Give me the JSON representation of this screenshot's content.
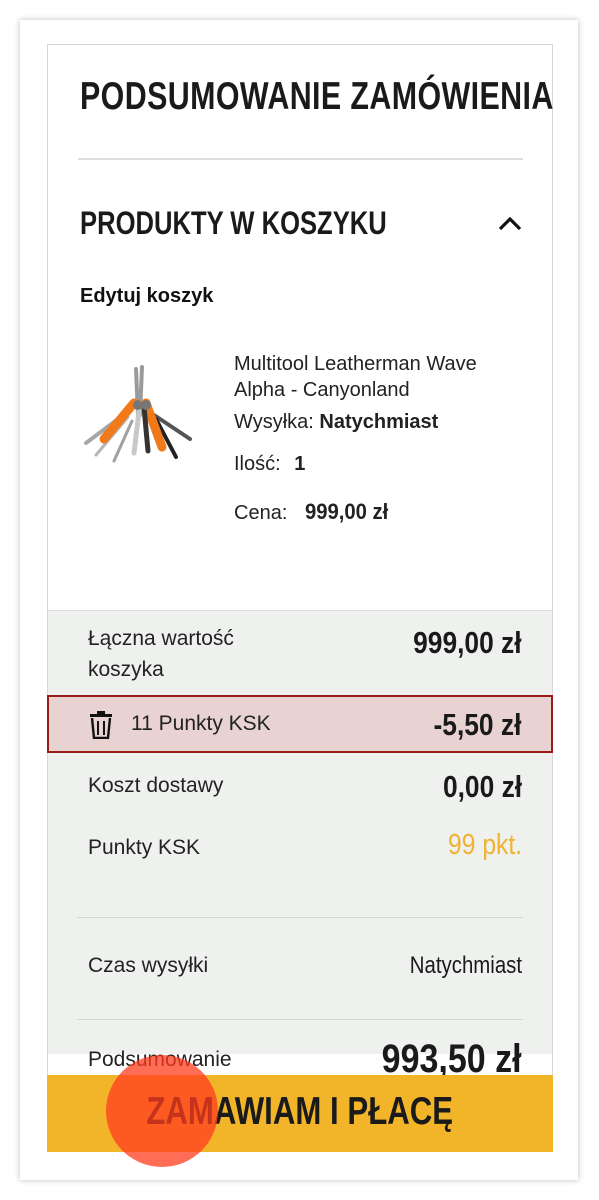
{
  "order_summary": {
    "title": "PODSUMOWANIE ZAMÓWIENIA",
    "cart_section": {
      "heading": "PRODUKTY W KOSZYKU",
      "toggle_icon": "chevron-up-icon",
      "edit_link": "Edytuj koszyk"
    },
    "product": {
      "name": "Multitool Leatherman Wave Alpha - Canyonland",
      "shipping_label": "Wysyłka:",
      "shipping_value": "Natychmiast",
      "qty_label": "Ilość:",
      "qty_value": "1",
      "price_label": "Cena:",
      "price_value": "999,00 zł"
    },
    "totals": {
      "cart_value_label": "Łączna wartość koszyka",
      "cart_value": "999,00 zł",
      "discount_label": "11 Punkty KSK",
      "discount_value": "-5,50 zł",
      "discount_icon": "trash-icon",
      "delivery_label": "Koszt dostawy",
      "delivery_value": "0,00 zł",
      "points_label": "Punkty KSK",
      "points_value": "99 pkt.",
      "ship_time_label": "Czas wysyłki",
      "ship_time_value": "Natychmiast",
      "summary_label": "Podsumowanie",
      "summary_value": "993,50 zł"
    },
    "cta_label": "ZAMAWIAM I PŁACĘ"
  },
  "colors": {
    "accent_yellow": "#f2b52a",
    "discount_border": "#9b1b1b",
    "discount_bg": "#e8d3d2",
    "points_color": "#f0b230",
    "summary_bg": "#eff1ef"
  }
}
